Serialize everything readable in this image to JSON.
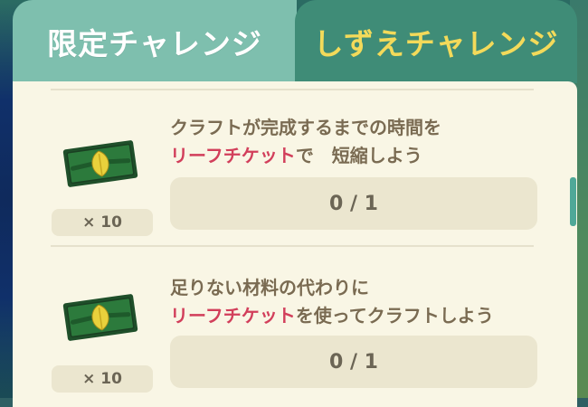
{
  "tabs": [
    {
      "label": "限定チャレンジ",
      "active": false
    },
    {
      "label": "しずえチャレンジ",
      "active": true
    }
  ],
  "challenges": [
    {
      "line1": "クラフトが完成するまでの時間を",
      "line2_highlight": "リーフチケット",
      "line2_rest": "で　短縮しよう",
      "progress": "0 / 1",
      "reward_count": "× 10",
      "reward_icon": "leaf-ticket-icon"
    },
    {
      "line1": "足りない材料の代わりに",
      "line2_highlight": "リーフチケット",
      "line2_rest": "を使ってクラフトしよう",
      "progress": "0 / 1",
      "reward_count": "× 10",
      "reward_icon": "leaf-ticket-icon"
    }
  ],
  "colors": {
    "tab_inactive": "#7ebfae",
    "tab_active": "#3f8c77",
    "active_tab_text": "#f3da5a",
    "panel": "#f9f6e5",
    "highlight_text": "#d23f5b",
    "body_text": "#7a6b52"
  }
}
